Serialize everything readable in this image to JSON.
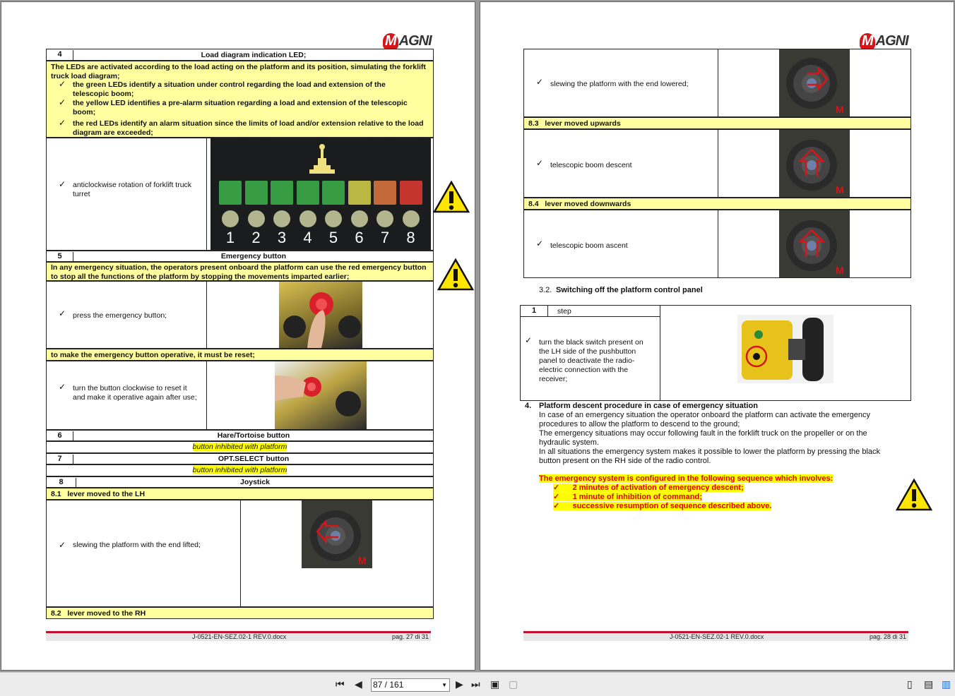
{
  "brand": "MAGNI",
  "left_page": {
    "row4": {
      "num": "4",
      "title": "Load diagram indication LED;"
    },
    "led_intro": "The LEDs are activated according to the load acting on the platform and its position, simulating the forklift truck load diagram;",
    "led_bullets": [
      "the green LEDs identify a situation under control regarding the load and extension of the telescopic boom;",
      "the yellow LED identifies a pre-alarm situation regarding a load and extension of the telescopic boom;",
      "the red LEDs identify an alarm situation since the limits of load and/or extension relative to the load diagram are exceeded;"
    ],
    "anticlockwise": "anticlockwise rotation of forklift truck turret",
    "led_numbers": [
      "1",
      "2",
      "3",
      "4",
      "5",
      "6",
      "7",
      "8"
    ],
    "led_colors": [
      "#3db34a",
      "#3db34a",
      "#3db34a",
      "#3db34a",
      "#3db34a",
      "#d8d24a",
      "#e07840",
      "#e33a32"
    ],
    "row5": {
      "num": "5",
      "title": "Emergency button"
    },
    "emergency_intro": "In any emergency situation, the operators present onboard the platform can use the red emergency button to stop all the functions of the platform by stopping the movements imparted earlier;",
    "press": "press the emergency button;",
    "reset_heading": "to make the emergency button operative, it must be reset;",
    "reset_text": "turn the button clockwise to reset it and make it operative again after use;",
    "row6": {
      "num": "6",
      "title": "Hare/Tortoise button"
    },
    "inhibited": "button inhibited with platform",
    "row7": {
      "num": "7",
      "title": "OPT.SELECT button"
    },
    "row8": {
      "num": "8",
      "title": "Joystick"
    },
    "sub81": "8.1   lever moved to the LH",
    "slew_lifted": "slewing the platform with the end lifted;",
    "sub82": "8.2   lever moved to the RH",
    "footer_doc": "J-0521-EN-SEZ.02-1 REV.0.docx",
    "footer_page": "pag. 27 di 31"
  },
  "right_page": {
    "slew_lowered": "slewing the platform with the end lowered;",
    "sub83": "8.3   lever moved upwards",
    "descent": "telescopic boom descent",
    "sub84": "8.4   lever moved downwards",
    "ascent": "telescopic boom ascent",
    "section32": "3.2.",
    "section32_title": "Switching off the platform control panel",
    "step_num": "1",
    "step_label": "step",
    "step_text": "turn the black switch present on the LH side of the pushbutton panel to deactivate the radio-electric connection with the receiver;",
    "section4_num": "4.",
    "section4_title": "Platform descent procedure in case of emergency situation",
    "para1": "In case of an emergency situation the operator onboard the platform can activate the emergency procedures to allow the platform to descend to the ground;",
    "para2": "The emergency situations may occur following fault in the forklift truck on the propeller or on the hydraulic system.",
    "para3": "In all situations the emergency system makes it possible to lower the platform by pressing the black button present on the RH side of the radio control.",
    "seq_intro": "The emergency system is configured in the following sequence which involves:",
    "seq_items": [
      "2 minutes of activation of emergency descent;",
      "1 minute of inhibition of command;",
      "successive resumption of sequence described above."
    ],
    "footer_doc": "J-0521-EN-SEZ.02-1 REV.0.docx",
    "footer_page": "pag. 28 di 31"
  },
  "toolbar": {
    "page_indicator": "87 / 161"
  }
}
